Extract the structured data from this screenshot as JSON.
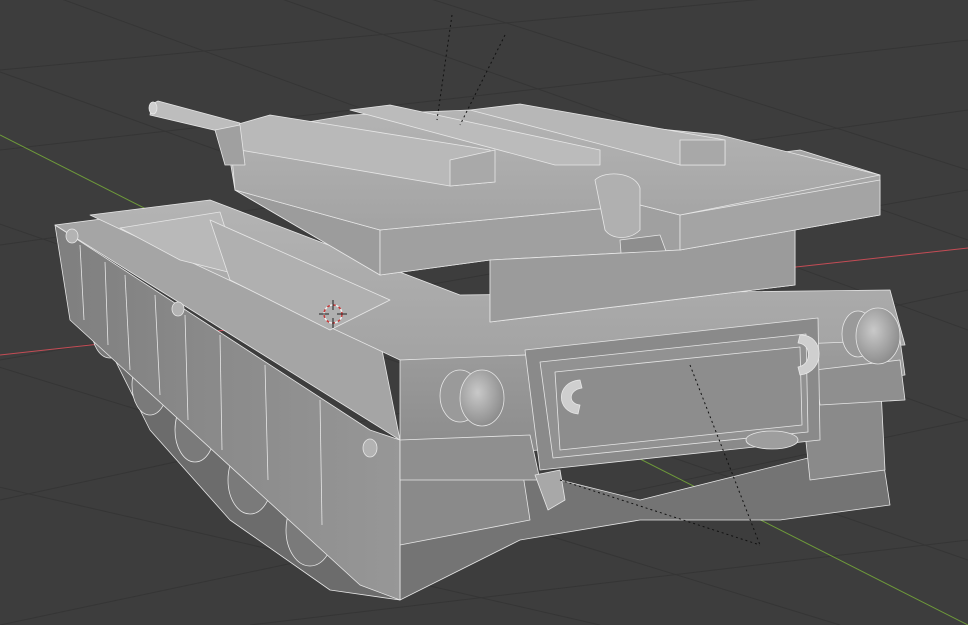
{
  "viewport": {
    "background": "#3d3d3d",
    "grid_color": "#353535",
    "x_axis_color": "#c44c55",
    "y_axis_color": "#6e9a3a"
  },
  "scene": {
    "object": "tank",
    "mesh_color": "#9a9a9a",
    "shading": "solid",
    "cursor": "3d-cursor-icon"
  }
}
